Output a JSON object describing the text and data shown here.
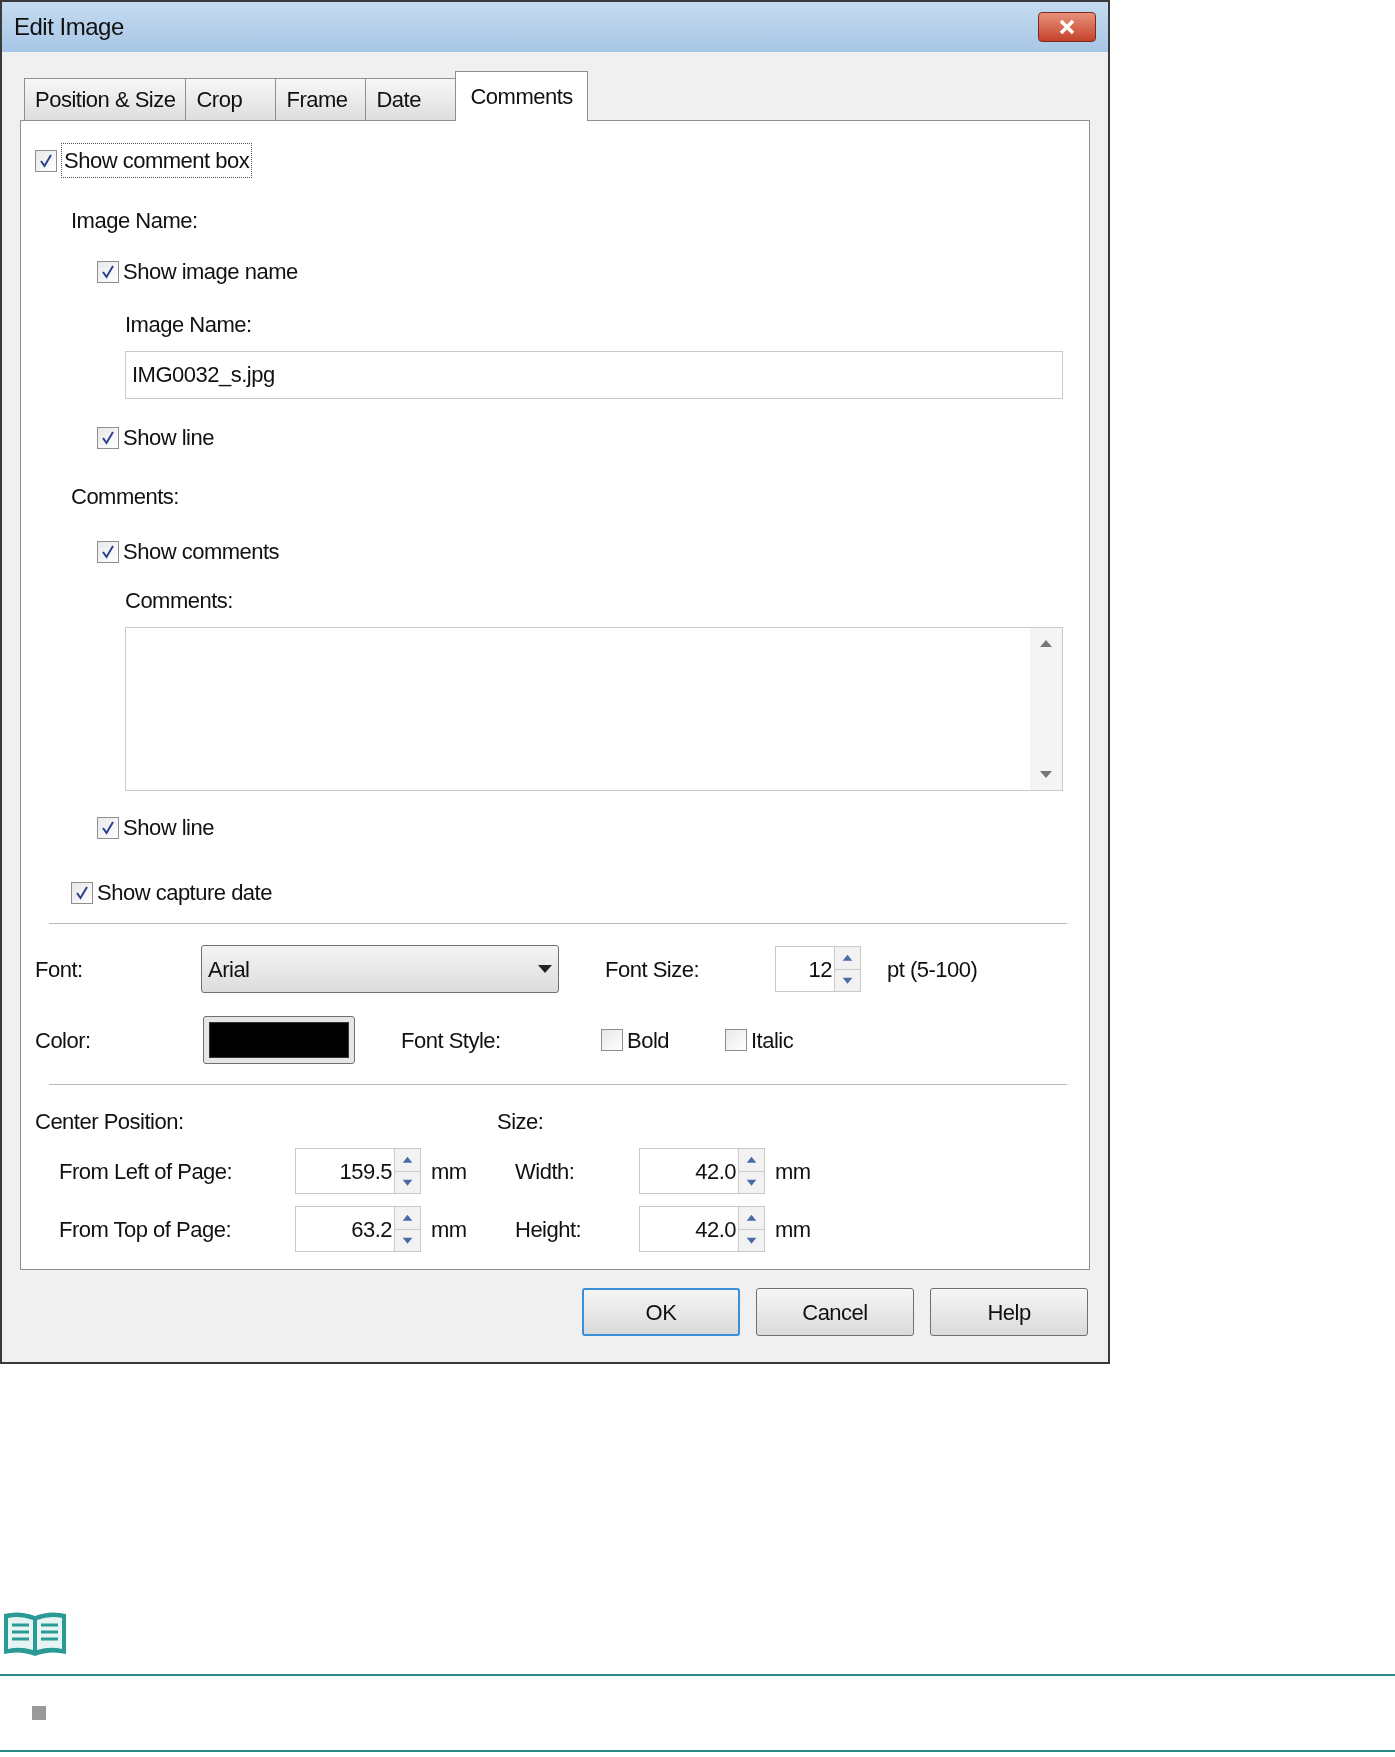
{
  "window": {
    "title": "Edit Image"
  },
  "tabs": [
    {
      "label": "Position & Size",
      "selected": false
    },
    {
      "label": "Crop",
      "selected": false
    },
    {
      "label": "Frame",
      "selected": false
    },
    {
      "label": "Date",
      "selected": false
    },
    {
      "label": "Comments",
      "selected": true
    }
  ],
  "show_comment_box": {
    "label": "Show comment box",
    "checked": true
  },
  "image_name": {
    "heading": "Image Name:",
    "show_image_name": {
      "label": "Show image name",
      "checked": true
    },
    "field_label": "Image Name:",
    "value": "IMG0032_s.jpg",
    "show_line": {
      "label": "Show line",
      "checked": true
    }
  },
  "comments": {
    "heading": "Comments:",
    "show_comments": {
      "label": "Show comments",
      "checked": true
    },
    "field_label": "Comments:",
    "show_line": {
      "label": "Show line",
      "checked": true
    }
  },
  "show_capture_date": {
    "label": "Show capture date",
    "checked": true
  },
  "font": {
    "label": "Font:",
    "value": "Arial"
  },
  "font_size": {
    "label": "Font Size:",
    "value": "12",
    "range": "pt (5-100)"
  },
  "color": {
    "label": "Color:",
    "color": "#000000"
  },
  "font_style": {
    "label": "Font Style:",
    "options": [
      {
        "label": "Bold",
        "checked": false
      },
      {
        "label": "Italic",
        "checked": false
      }
    ]
  },
  "center_position": {
    "heading": "Center Position:",
    "fields": [
      {
        "label": "From Left of Page:",
        "value": "159.5",
        "unit": "mm"
      },
      {
        "label": "From Top of Page:",
        "value": "63.2",
        "unit": "mm"
      }
    ]
  },
  "size": {
    "heading": "Size:",
    "fields": [
      {
        "label": "Width:",
        "value": "42.0",
        "unit": "mm"
      },
      {
        "label": "Height:",
        "value": "42.0",
        "unit": "mm"
      }
    ]
  },
  "buttons": [
    {
      "label": "OK",
      "default": true
    },
    {
      "label": "Cancel",
      "default": false
    },
    {
      "label": "Help",
      "default": false
    }
  ]
}
